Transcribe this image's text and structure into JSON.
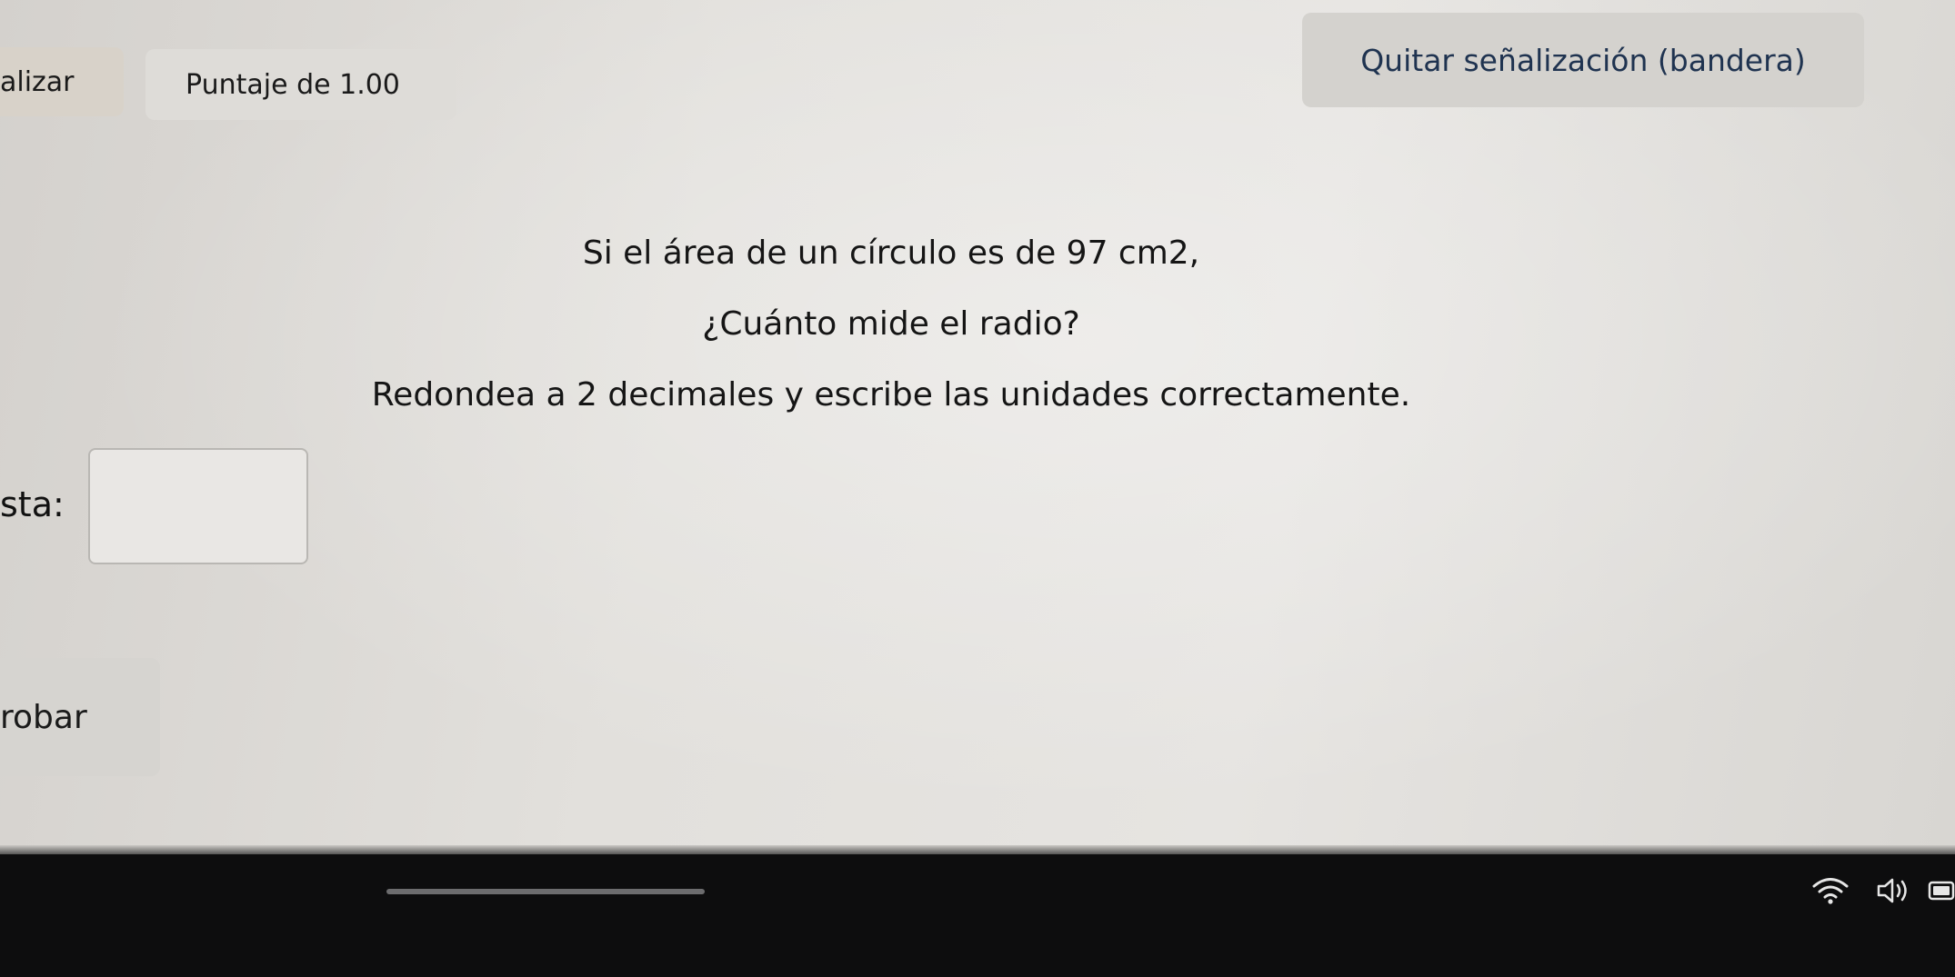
{
  "toolbar": {
    "finalize_label": "alizar",
    "score_label": "Puntaje de 1.00",
    "flag_label": "Quitar señalización (bandera)"
  },
  "question": {
    "line1": "Si el área de un círculo es de 97 cm2,",
    "line2": "¿Cuánto mide el radio?",
    "line3": "Redondea a 2 decimales y escribe las unidades correctamente."
  },
  "answer": {
    "label": "sta:",
    "value": ""
  },
  "actions": {
    "check_label": "robar"
  },
  "taskbar": {
    "icons": [
      "wifi-icon",
      "volume-icon",
      "battery-icon"
    ]
  }
}
